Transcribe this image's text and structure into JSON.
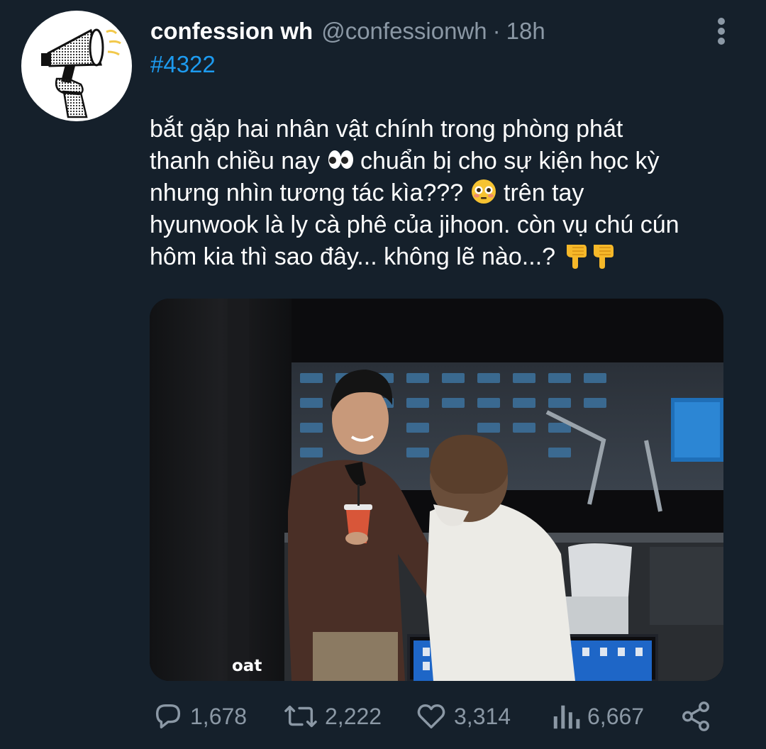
{
  "tweet": {
    "author_name": "confession wh",
    "handle": "@confessionwh",
    "separator": "·",
    "time": "18h",
    "hashtag": "#4322",
    "body": {
      "line1": "bắt gặp hai nhân vật chính trong phòng phát",
      "line2a": "thanh chiều nay",
      "line2b": "chuẩn bị cho sự kiện học kỳ",
      "line3a": "nhưng nhìn tương tác kìa???",
      "line3b": "trên tay",
      "line4": "hyunwook là ly cà phê của jihoon. còn vụ chú cún",
      "line5": "hôm kia thì sao đây... không lẽ nào...?"
    },
    "emojis": [
      "eyes-emoji",
      "flushed-face-emoji",
      "backhand-index-pointing-down-emoji",
      "backhand-index-pointing-down-emoji"
    ],
    "media": {
      "watermark": "oat"
    },
    "actions": {
      "replies": "1,678",
      "retweets": "2,222",
      "likes": "3,314",
      "views": "6,667"
    },
    "icons": [
      "more-icon",
      "reply-icon",
      "retweet-icon",
      "like-icon",
      "views-icon",
      "share-icon"
    ]
  },
  "colors": {
    "background": "#15202b",
    "text": "#ffffff",
    "secondary": "#8b98a5",
    "link": "#1d9bf0"
  }
}
